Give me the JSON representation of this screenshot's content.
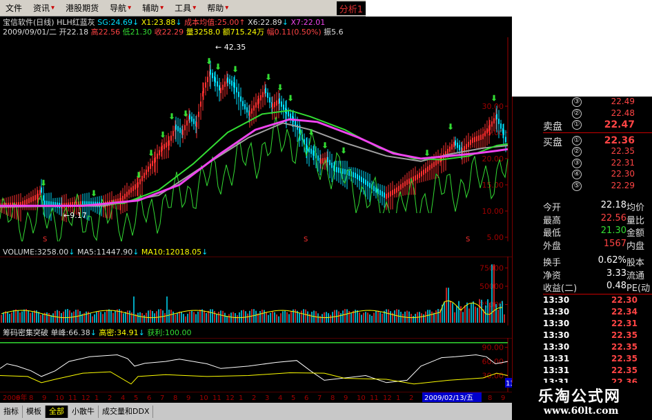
{
  "menu": [
    {
      "label": "文件"
    },
    {
      "label": "资讯"
    },
    {
      "label": "港股期货"
    },
    {
      "label": "导航"
    },
    {
      "label": "辅助"
    },
    {
      "label": "工具"
    },
    {
      "label": "帮助"
    }
  ],
  "analysis_tab": "分析1",
  "chart": {
    "title_line": {
      "stock": "宝信软件(日线)",
      "indicator": "HLH红蓝灰",
      "sg": "SG:24.69",
      "x1": "X1:23.88",
      "cost": "成本均值:25.00",
      "x6": "X6:22.89",
      "x7": "X7:22.01"
    },
    "ohlc_line": {
      "date": "2009/09/01/二",
      "open": "开22.18",
      "high": "高22.56",
      "low": "低21.30",
      "close": "收22.29",
      "vol": "量3258.0",
      "amount": "额715.24万",
      "change": "幅0.11(0.50%)",
      "amp": "振5.6"
    },
    "peak_label": "42.35",
    "low_label": "9.17",
    "price_axis": [
      "30.00",
      "25.00",
      "20.00",
      "15.00",
      "10.00",
      "5.00"
    ],
    "volume_header": {
      "volume": "VOLUME:3258.00",
      "ma5": "MA5:11447.90",
      "ma10": "MA10:12018.05"
    },
    "volume_axis": [
      "75000",
      "50000",
      "25000"
    ],
    "indicator_header": {
      "name": "筹码密集突破",
      "single_peak": "单峰:66.38",
      "high_dense": "高密:34.91",
      "profit": "获利:100.00"
    },
    "indicator_axis": [
      "90.00",
      "60.00",
      "30.00"
    ],
    "date_axis": [
      "2009年",
      "6",
      "8",
      "9",
      "10",
      "11",
      "12",
      "1",
      "2",
      "4",
      "5",
      "6",
      "7",
      "8",
      "9",
      "10",
      "11",
      "12",
      "1",
      "2",
      "3",
      "4",
      "5",
      "6",
      "7",
      "8",
      "9",
      "10",
      "11",
      "12",
      "1",
      "2",
      "3",
      "4",
      "5",
      "6",
      "7",
      "8",
      "9"
    ],
    "date_cursor": "2009/02/13/五",
    "axis_cursor": "13.",
    "colors": {
      "up": "#ff3030",
      "down": "#00e0ff",
      "ma_green": "#33dd33",
      "ma_magenta": "#ee44ee",
      "ma_gray": "#a0a0a0",
      "axis": "#a00000"
    }
  },
  "quote": {
    "sell": [
      {
        "label": "",
        "num": "③",
        "price": "22.49"
      },
      {
        "label": "",
        "num": "②",
        "price": "22.48"
      },
      {
        "label": "卖盘",
        "num": "①",
        "price": "22.47"
      }
    ],
    "buy": [
      {
        "label": "买盘",
        "num": "①",
        "price": "22.36"
      },
      {
        "label": "",
        "num": "②",
        "price": "22.35"
      },
      {
        "label": "",
        "num": "③",
        "price": "22.31"
      },
      {
        "label": "",
        "num": "④",
        "price": "22.30"
      },
      {
        "label": "",
        "num": "⑤",
        "price": "22.29"
      }
    ],
    "stats_a": [
      {
        "k": "今开",
        "v": "22.18",
        "k2": "均价",
        "color": "#ffffff"
      },
      {
        "k": "最高",
        "v": "22.56",
        "k2": "量比",
        "color": "#ff4444"
      },
      {
        "k": "最低",
        "v": "21.30",
        "k2": "金额",
        "color": "#33dd33"
      },
      {
        "k": "外盘",
        "v": "1567",
        "k2": "内盘",
        "color": "#ff4444"
      }
    ],
    "stats_b": [
      {
        "k": "换手",
        "v": "0.62%",
        "k2": "股本",
        "color": "#ffffff"
      },
      {
        "k": "净资",
        "v": "3.33",
        "k2": "流通",
        "color": "#ffffff"
      },
      {
        "k": "收益(二)",
        "v": "0.48",
        "k2": "PE(动",
        "color": "#ffffff"
      }
    ],
    "ticks": [
      {
        "t": "13:30",
        "p": "22.30"
      },
      {
        "t": "13:30",
        "p": "22.34"
      },
      {
        "t": "13:30",
        "p": "22.31"
      },
      {
        "t": "13:30",
        "p": "22.35"
      },
      {
        "t": "13:30",
        "p": "22.35"
      },
      {
        "t": "13:31",
        "p": "22.35"
      },
      {
        "t": "13:31",
        "p": "22.35"
      },
      {
        "t": "13:31",
        "p": "22.36"
      }
    ]
  },
  "bottom_tabs": [
    "指标",
    "模板",
    "全部",
    "小散牛",
    "成交量和DDX"
  ],
  "watermark": {
    "title": "乐淘公式网",
    "url": "www.60lt.com"
  }
}
